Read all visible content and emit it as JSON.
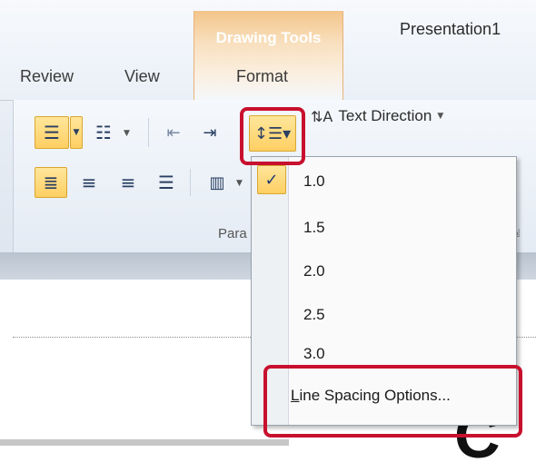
{
  "context_tab": {
    "title": "Drawing Tools"
  },
  "window_title": "Presentation1",
  "tabs": [
    {
      "label": "Review"
    },
    {
      "label": "View"
    },
    {
      "label": "Format"
    }
  ],
  "ribbon": {
    "text_direction_label": "Text Direction",
    "paragraph_group_label": "Para"
  },
  "line_spacing_menu": {
    "items": [
      {
        "label": "1.0",
        "checked": true
      },
      {
        "label": "1.5"
      },
      {
        "label": "2.0"
      },
      {
        "label": "2.5"
      },
      {
        "label": "3.0"
      }
    ],
    "options_label": "Line Spacing Options..."
  },
  "colors": {
    "highlight": "#c8102e",
    "active_button": "#ffcf63",
    "context_tab": "#f3c58a"
  }
}
